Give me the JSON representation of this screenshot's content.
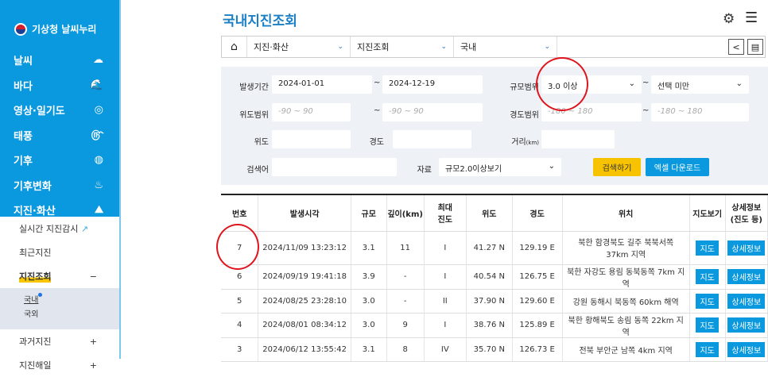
{
  "sidebar": {
    "logo": "기상청 날씨누리",
    "nav": [
      {
        "label": "날씨",
        "icon": "☁"
      },
      {
        "label": "바다",
        "icon": "🌊"
      },
      {
        "label": "영상·일기도",
        "icon": "◎"
      },
      {
        "label": "태풍",
        "icon": "௹"
      },
      {
        "label": "기후",
        "icon": "◍"
      },
      {
        "label": "기후변화",
        "icon": "♨"
      },
      {
        "label": "지진·화산",
        "icon": "⛰"
      }
    ],
    "sub": [
      {
        "label": "실시간 지진감시",
        "ext": "↗"
      },
      {
        "label": "최근지진"
      },
      {
        "label": "지진조회",
        "mark": "−"
      },
      {
        "label": "과거지진",
        "mark": "+"
      },
      {
        "label": "지진해일",
        "mark": "+"
      }
    ],
    "subsub": [
      "국내",
      "국외"
    ]
  },
  "header": {
    "title": "국내지진조회"
  },
  "crumb": {
    "items": [
      "지진·화산",
      "지진조회",
      "국내"
    ]
  },
  "form": {
    "period_label": "발생기간",
    "start": "2024-01-01",
    "end": "2024-12-19",
    "tilde": "~",
    "mag_label": "규모범위",
    "mag_min": "3.0 이상",
    "mag_max": "선택 미만",
    "lat_range_label": "위도범위",
    "lat_ph": "-90 ~ 90",
    "lon_range_label": "경도범위",
    "lon_ph": "-180 ~ 180",
    "lat_label": "위도",
    "lon_label": "경도",
    "dist_label": "거리",
    "dist_unit": "(km)",
    "keyword_label": "검색어",
    "data_label": "자료",
    "data_value": "규모2.0이상보기",
    "search_btn": "검색하기",
    "excel_btn": "엑셀 다운로드"
  },
  "table": {
    "headers": [
      "번호",
      "발생시각",
      "규모",
      "깊이(km)",
      "최대\n진도",
      "위도",
      "경도",
      "위치",
      "지도보기",
      "상세정보\n(진도 등)"
    ],
    "map_btn": "지도",
    "detail_btn": "상세정보",
    "rows": [
      [
        "7",
        "2024/11/09 13:23:12",
        "3.1",
        "11",
        "I",
        "41.27 N",
        "129.19 E",
        "북한 함경북도 길주 북북서쪽 37km 지역"
      ],
      [
        "6",
        "2024/09/19 19:41:18",
        "3.9",
        "-",
        "I",
        "40.54 N",
        "126.75 E",
        "북한 자강도 용림 동북동쪽 7km 지역"
      ],
      [
        "5",
        "2024/08/25 23:28:10",
        "3.0",
        "-",
        "II",
        "37.90 N",
        "129.60 E",
        "강원 동해시 북동쪽 60km 해역"
      ],
      [
        "4",
        "2024/08/01 08:34:12",
        "3.0",
        "9",
        "I",
        "38.76 N",
        "125.89 E",
        "북한 황해북도 송림 동쪽 22km 지역"
      ],
      [
        "3",
        "2024/06/12 13:55:42",
        "3.1",
        "8",
        "IV",
        "35.70 N",
        "126.73 E",
        "전북 부안군 남쪽 4km 지역"
      ]
    ]
  }
}
